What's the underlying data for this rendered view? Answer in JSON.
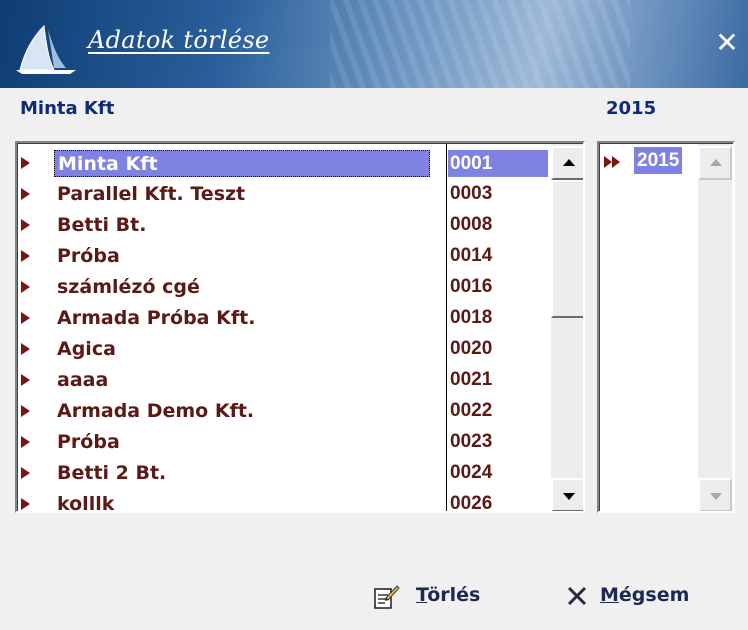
{
  "window": {
    "title": "Adatok törlése",
    "close_glyph": "✕"
  },
  "company_header": "Minta Kft",
  "year_header": "2015",
  "companies": [
    {
      "name": "Minta Kft",
      "code": "0001",
      "selected": true
    },
    {
      "name": "Parallel Kft. Teszt",
      "code": "0003"
    },
    {
      "name": "Betti Bt.",
      "code": "0008"
    },
    {
      "name": "Próba",
      "code": "0014"
    },
    {
      "name": "számlézó cgé",
      "code": "0016"
    },
    {
      "name": "Armada Próba Kft.",
      "code": "0018"
    },
    {
      "name": "Agica",
      "code": "0020"
    },
    {
      "name": "aaaa",
      "code": "0021"
    },
    {
      "name": "Armada Demo Kft.",
      "code": "0022"
    },
    {
      "name": "Próba",
      "code": "0023"
    },
    {
      "name": "Betti 2 Bt.",
      "code": "0024"
    },
    {
      "name": "kolllk",
      "code": "0026"
    }
  ],
  "years": [
    {
      "value": "2015",
      "selected": true
    }
  ],
  "buttons": {
    "delete_label": "Törlés",
    "cancel_label": "Mégsem"
  },
  "icons": {
    "logo": "sail-logo-icon",
    "delete": "delete-document-icon",
    "cancel": "cancel-x-icon"
  },
  "colors": {
    "title_gradient_dark": "#0f3d74",
    "header_text": "#0e2a78",
    "row_text": "#5b1a16",
    "selection": "#7f82e0",
    "marker": "#7b1512"
  }
}
